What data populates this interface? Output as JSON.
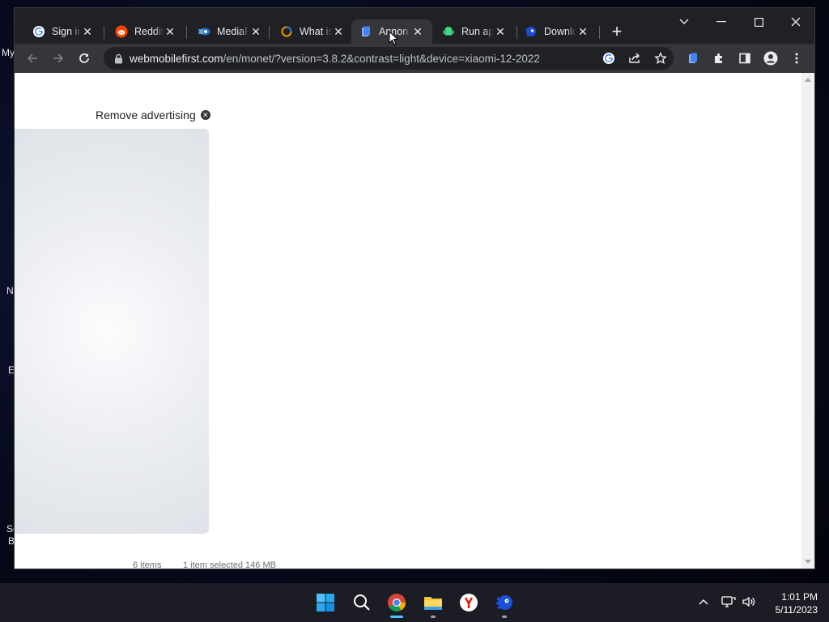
{
  "desktop": {
    "fragments": [
      "My",
      "N",
      "E",
      "So",
      "B"
    ]
  },
  "tabs": [
    {
      "label": "Sign in",
      "icon": "google-icon"
    },
    {
      "label": "Reddit",
      "icon": "reddit-icon"
    },
    {
      "label": "MediaF",
      "icon": "mediafire-icon"
    },
    {
      "label": "What is",
      "icon": "ring-icon"
    },
    {
      "label": "Annon",
      "icon": "docs-icon",
      "active": true
    },
    {
      "label": "Run ap",
      "icon": "android-icon"
    },
    {
      "label": "Downlo",
      "icon": "sonic-icon"
    }
  ],
  "toolbar": {
    "url_host": "webmobilefirst.com",
    "url_path": "/en/monet/?version=3.8.2&contrast=light&device=xiaomi-12-2022"
  },
  "page": {
    "remove_ad": "Remove advertising"
  },
  "explorer_status": {
    "items": "6 items",
    "selected": "1 item selected  146 MB"
  },
  "clock": {
    "time": "1:01 PM",
    "date": "5/11/2023"
  }
}
